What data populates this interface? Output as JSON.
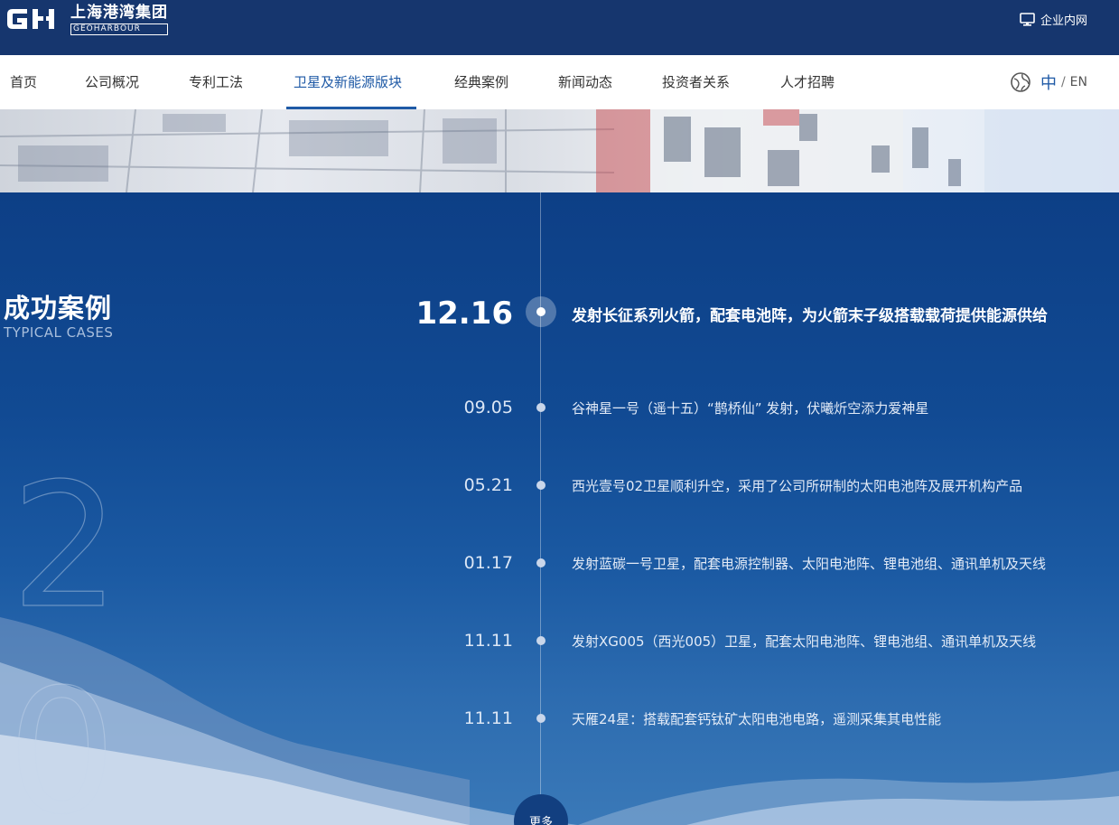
{
  "header": {
    "logo_cn": "上海港湾集团",
    "logo_en": "GEOHARBOUR",
    "intranet_label": "企业内网",
    "icons": {
      "intranet": "monitor-icon",
      "language": "globe-icon"
    }
  },
  "nav": {
    "items": [
      "首页",
      "公司概况",
      "专利工法",
      "卫星及新能源版块",
      "经典案例",
      "新闻动态",
      "投资者关系",
      "人才招聘"
    ],
    "active_index": 3,
    "lang_zh": "中",
    "lang_sep": "/",
    "lang_en": "EN"
  },
  "section": {
    "title": "成功案例",
    "subtitle": "TYPICAL CASES",
    "year_digits": [
      "2",
      "0"
    ]
  },
  "timeline": [
    {
      "date": "12.16",
      "text": "发射长征系列火箭，配套电池阵，为火箭末子级搭载载荷提供能源供给"
    },
    {
      "date": "09.05",
      "text": "谷神星一号（遥十五）“鹊桥仙” 发射，伏曦炘空添力爱神星"
    },
    {
      "date": "05.21",
      "text": "西光壹号02卫星顺利升空，采用了公司所研制的太阳电池阵及展开机构产品"
    },
    {
      "date": "01.17",
      "text": "发射蓝碳一号卫星，配套电源控制器、太阳电池阵、锂电池组、通讯单机及天线"
    },
    {
      "date": "11.11",
      "text": "发射XG005（西光005）卫星，配套太阳电池阵、锂电池组、通讯单机及天线"
    },
    {
      "date": "11.11",
      "text": "天雁24星：搭载配套钙钛矿太阳电池电路，遥测采集其电性能"
    }
  ],
  "more_label": "更多",
  "colors": {
    "topbar": "#16366e",
    "accent": "#1f5aa6",
    "main_bg": "#0d3f86"
  }
}
